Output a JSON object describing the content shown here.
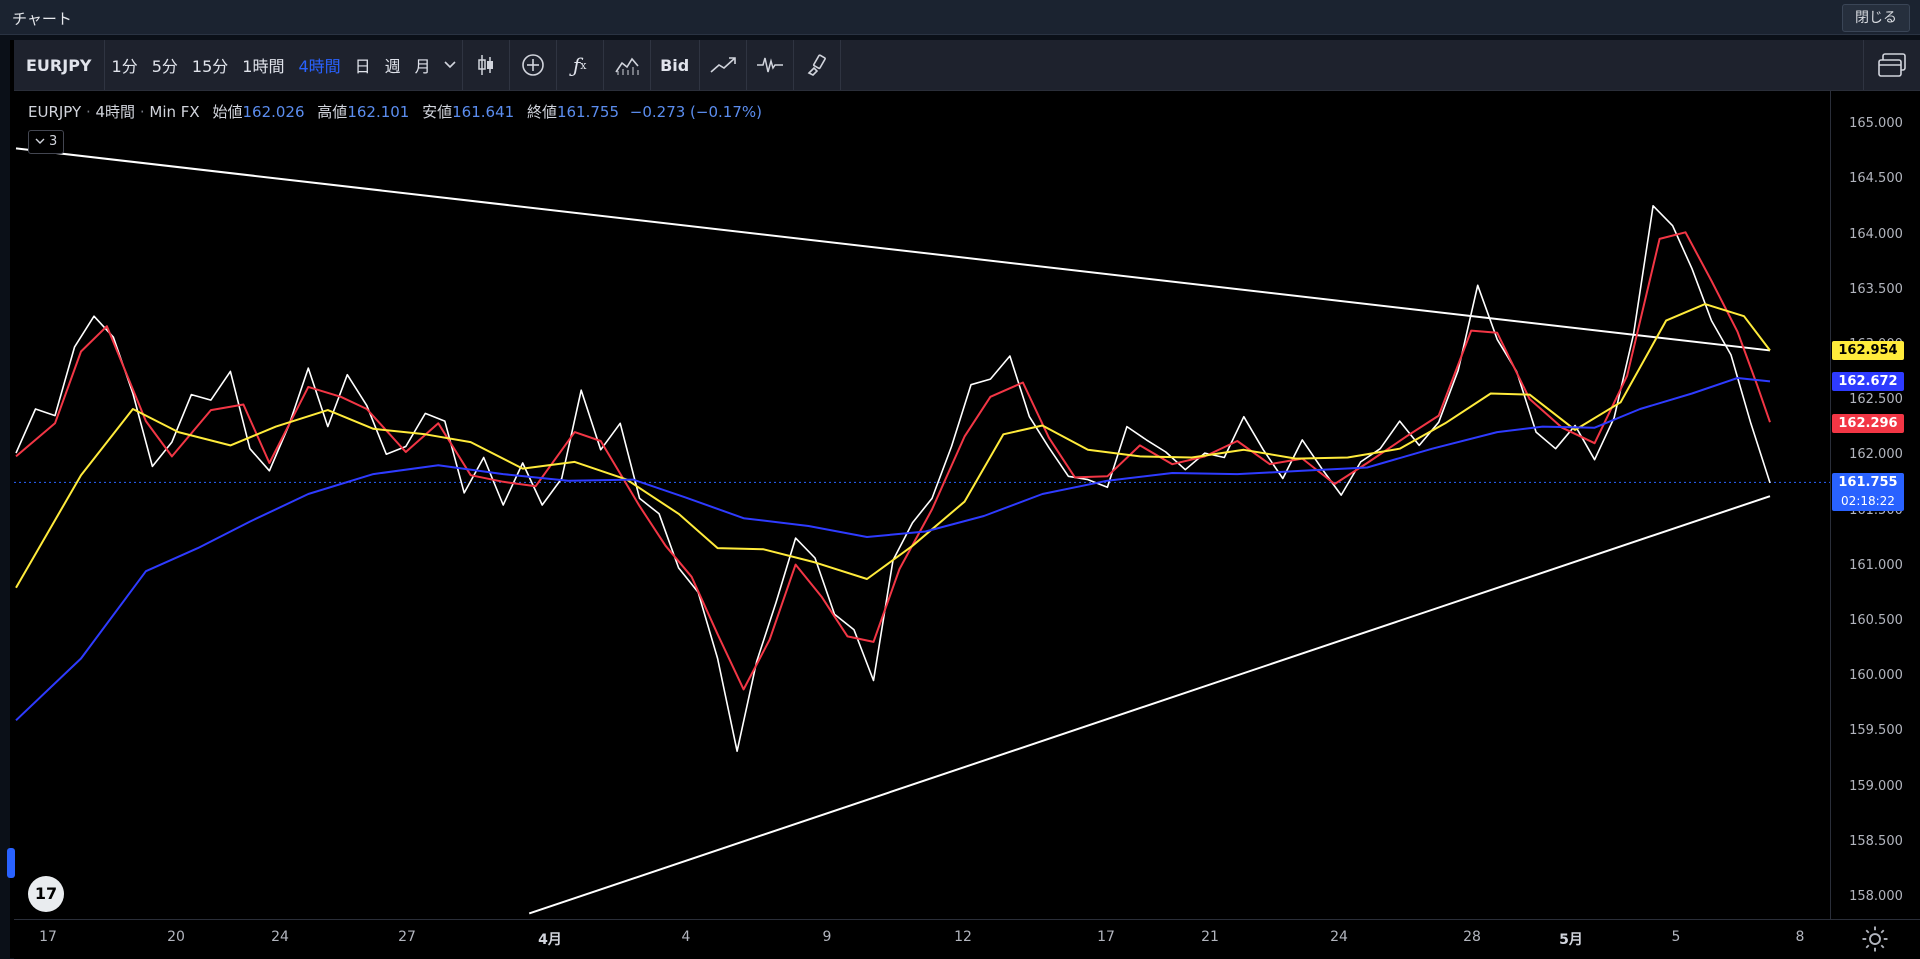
{
  "window": {
    "title": "チャート",
    "close_label": "閉じる"
  },
  "toolbar": {
    "symbol": "EURJPY",
    "intervals": [
      "1分",
      "5分",
      "15分",
      "1時間",
      "4時間",
      "日",
      "週",
      "月"
    ],
    "active_interval": "4時間",
    "bid_label": "Bid",
    "icons": [
      "candlestick-icon",
      "add-compare-icon",
      "indicators-icon",
      "chart-type-icon",
      "bid-button",
      "line-tool-icon",
      "waveform-icon",
      "brush-icon",
      "layout-icon"
    ]
  },
  "legend": {
    "symbol": "EURJPY",
    "interval": "4時間",
    "source": "Min FX",
    "open_label": "始値",
    "open": "162.026",
    "high_label": "高値",
    "high": "162.101",
    "low_label": "安値",
    "low": "161.641",
    "close_label": "終値",
    "close": "161.755",
    "change": "−0.273 (−0.17%)",
    "indicators_toggle": "3"
  },
  "price_axis": {
    "ticks": [
      "165.000",
      "164.500",
      "164.000",
      "163.500",
      "163.000",
      "162.500",
      "162.000",
      "161.500",
      "161.000",
      "160.500",
      "160.000",
      "159.500",
      "159.000",
      "158.500",
      "158.000"
    ]
  },
  "price_labels": {
    "ma_slow": {
      "value": "162.954",
      "color": "#ffeb3b"
    },
    "ma_long": {
      "value": "162.672",
      "color": "#2e3bff"
    },
    "ma_fast": {
      "value": "162.296",
      "color": "#f23645"
    },
    "last": {
      "value": "161.755",
      "countdown": "02:18:22",
      "color": "#2962ff"
    }
  },
  "time_axis": {
    "ticks": [
      "17",
      "20",
      "24",
      "27",
      "4月",
      "4",
      "9",
      "12",
      "17",
      "21",
      "24",
      "28",
      "5月",
      "5",
      "8"
    ]
  },
  "chart_data": {
    "type": "line",
    "title": "EURJPY · 4時間 · Min FX",
    "y_range": [
      157.8,
      165.3
    ],
    "series": [
      {
        "color": "#ffffff",
        "points": [
          [
            0,
            162.02
          ],
          [
            6,
            162.42
          ],
          [
            12,
            162.36
          ],
          [
            18,
            162.98
          ],
          [
            24,
            163.26
          ],
          [
            30,
            163.07
          ],
          [
            36,
            162.56
          ],
          [
            42,
            161.9
          ],
          [
            48,
            162.12
          ],
          [
            54,
            162.55
          ],
          [
            60,
            162.5
          ],
          [
            66,
            162.76
          ],
          [
            72,
            162.06
          ],
          [
            78,
            161.86
          ],
          [
            84,
            162.27
          ],
          [
            90,
            162.79
          ],
          [
            96,
            162.26
          ],
          [
            102,
            162.73
          ],
          [
            108,
            162.45
          ],
          [
            114,
            162.01
          ],
          [
            120,
            162.08
          ],
          [
            126,
            162.38
          ],
          [
            132,
            162.31
          ],
          [
            138,
            161.66
          ],
          [
            144,
            161.98
          ],
          [
            150,
            161.55
          ],
          [
            156,
            161.93
          ],
          [
            162,
            161.55
          ],
          [
            168,
            161.79
          ],
          [
            174,
            162.59
          ],
          [
            180,
            162.05
          ],
          [
            186,
            162.29
          ],
          [
            192,
            161.61
          ],
          [
            198,
            161.47
          ],
          [
            204,
            160.98
          ],
          [
            210,
            160.76
          ],
          [
            216,
            160.16
          ],
          [
            222,
            159.32
          ],
          [
            228,
            160.13
          ],
          [
            234,
            160.67
          ],
          [
            240,
            161.25
          ],
          [
            246,
            161.07
          ],
          [
            252,
            160.56
          ],
          [
            258,
            160.42
          ],
          [
            264,
            159.96
          ],
          [
            270,
            161.05
          ],
          [
            276,
            161.39
          ],
          [
            282,
            161.61
          ],
          [
            288,
            162.08
          ],
          [
            294,
            162.64
          ],
          [
            300,
            162.69
          ],
          [
            306,
            162.9
          ],
          [
            312,
            162.35
          ],
          [
            318,
            162.07
          ],
          [
            324,
            161.81
          ],
          [
            330,
            161.78
          ],
          [
            336,
            161.71
          ],
          [
            342,
            162.26
          ],
          [
            348,
            162.14
          ],
          [
            354,
            162.03
          ],
          [
            360,
            161.87
          ],
          [
            366,
            162.02
          ],
          [
            372,
            161.98
          ],
          [
            378,
            162.35
          ],
          [
            384,
            162.05
          ],
          [
            390,
            161.79
          ],
          [
            396,
            162.14
          ],
          [
            402,
            161.88
          ],
          [
            408,
            161.64
          ],
          [
            414,
            161.94
          ],
          [
            420,
            162.06
          ],
          [
            426,
            162.31
          ],
          [
            432,
            162.09
          ],
          [
            438,
            162.3
          ],
          [
            444,
            162.77
          ],
          [
            450,
            163.54
          ],
          [
            456,
            163.05
          ],
          [
            462,
            162.76
          ],
          [
            468,
            162.21
          ],
          [
            474,
            162.06
          ],
          [
            480,
            162.27
          ],
          [
            486,
            161.96
          ],
          [
            492,
            162.34
          ],
          [
            498,
            163.1
          ],
          [
            504,
            164.26
          ],
          [
            510,
            164.08
          ],
          [
            516,
            163.69
          ],
          [
            522,
            163.22
          ],
          [
            528,
            162.91
          ],
          [
            534,
            162.3
          ],
          [
            540,
            161.75
          ]
        ]
      },
      {
        "color": "#f23645",
        "points": [
          [
            0,
            161.99
          ],
          [
            12,
            162.29
          ],
          [
            20,
            162.94
          ],
          [
            28,
            163.17
          ],
          [
            40,
            162.31
          ],
          [
            48,
            161.99
          ],
          [
            60,
            162.41
          ],
          [
            70,
            162.46
          ],
          [
            78,
            161.93
          ],
          [
            90,
            162.62
          ],
          [
            100,
            162.53
          ],
          [
            108,
            162.42
          ],
          [
            120,
            162.03
          ],
          [
            130,
            162.29
          ],
          [
            140,
            161.82
          ],
          [
            150,
            161.76
          ],
          [
            160,
            161.72
          ],
          [
            172,
            162.21
          ],
          [
            180,
            162.13
          ],
          [
            192,
            161.54
          ],
          [
            200,
            161.18
          ],
          [
            208,
            160.9
          ],
          [
            216,
            160.38
          ],
          [
            224,
            159.88
          ],
          [
            232,
            160.33
          ],
          [
            240,
            161.01
          ],
          [
            248,
            160.72
          ],
          [
            256,
            160.36
          ],
          [
            264,
            160.31
          ],
          [
            272,
            160.97
          ],
          [
            282,
            161.51
          ],
          [
            292,
            162.17
          ],
          [
            300,
            162.53
          ],
          [
            310,
            162.66
          ],
          [
            318,
            162.16
          ],
          [
            326,
            161.8
          ],
          [
            336,
            161.81
          ],
          [
            346,
            162.09
          ],
          [
            356,
            161.92
          ],
          [
            366,
            161.99
          ],
          [
            376,
            162.13
          ],
          [
            386,
            161.92
          ],
          [
            396,
            161.97
          ],
          [
            406,
            161.74
          ],
          [
            416,
            161.93
          ],
          [
            428,
            162.17
          ],
          [
            438,
            162.36
          ],
          [
            448,
            163.13
          ],
          [
            456,
            163.11
          ],
          [
            466,
            162.51
          ],
          [
            476,
            162.25
          ],
          [
            486,
            162.11
          ],
          [
            496,
            162.72
          ],
          [
            506,
            163.96
          ],
          [
            514,
            164.02
          ],
          [
            522,
            163.58
          ],
          [
            530,
            163.12
          ],
          [
            536,
            162.64
          ],
          [
            540,
            162.3
          ]
        ]
      },
      {
        "color": "#ffeb3b",
        "points": [
          [
            0,
            160.8
          ],
          [
            20,
            161.82
          ],
          [
            36,
            162.42
          ],
          [
            50,
            162.21
          ],
          [
            66,
            162.09
          ],
          [
            80,
            162.26
          ],
          [
            96,
            162.41
          ],
          [
            110,
            162.24
          ],
          [
            126,
            162.19
          ],
          [
            140,
            162.12
          ],
          [
            156,
            161.88
          ],
          [
            172,
            161.94
          ],
          [
            188,
            161.78
          ],
          [
            204,
            161.47
          ],
          [
            216,
            161.16
          ],
          [
            230,
            161.15
          ],
          [
            246,
            161.03
          ],
          [
            262,
            160.88
          ],
          [
            276,
            161.18
          ],
          [
            292,
            161.58
          ],
          [
            304,
            162.19
          ],
          [
            316,
            162.27
          ],
          [
            330,
            162.05
          ],
          [
            346,
            161.99
          ],
          [
            362,
            161.98
          ],
          [
            378,
            162.05
          ],
          [
            394,
            161.97
          ],
          [
            410,
            161.98
          ],
          [
            426,
            162.06
          ],
          [
            440,
            162.29
          ],
          [
            454,
            162.56
          ],
          [
            466,
            162.55
          ],
          [
            480,
            162.23
          ],
          [
            494,
            162.48
          ],
          [
            508,
            163.22
          ],
          [
            520,
            163.37
          ],
          [
            532,
            163.26
          ],
          [
            540,
            162.95
          ]
        ]
      },
      {
        "color": "#2e3bff",
        "points": [
          [
            0,
            159.6
          ],
          [
            20,
            160.16
          ],
          [
            40,
            160.95
          ],
          [
            56,
            161.16
          ],
          [
            72,
            161.4
          ],
          [
            90,
            161.65
          ],
          [
            110,
            161.83
          ],
          [
            130,
            161.91
          ],
          [
            150,
            161.83
          ],
          [
            170,
            161.77
          ],
          [
            190,
            161.78
          ],
          [
            206,
            161.62
          ],
          [
            224,
            161.43
          ],
          [
            244,
            161.36
          ],
          [
            262,
            161.26
          ],
          [
            280,
            161.31
          ],
          [
            298,
            161.45
          ],
          [
            316,
            161.65
          ],
          [
            336,
            161.77
          ],
          [
            356,
            161.84
          ],
          [
            376,
            161.83
          ],
          [
            396,
            161.86
          ],
          [
            416,
            161.89
          ],
          [
            436,
            162.06
          ],
          [
            456,
            162.21
          ],
          [
            470,
            162.26
          ],
          [
            486,
            162.25
          ],
          [
            500,
            162.42
          ],
          [
            516,
            162.56
          ],
          [
            530,
            162.7
          ],
          [
            540,
            162.67
          ]
        ]
      }
    ],
    "trendlines": [
      {
        "color": "#ffffff",
        "from": [
          0,
          164.78
        ],
        "to": [
          540,
          162.95
        ]
      },
      {
        "color": "#ffffff",
        "from": [
          158,
          157.85
        ],
        "to": [
          540,
          161.63
        ]
      }
    ],
    "last_price": 161.755
  }
}
